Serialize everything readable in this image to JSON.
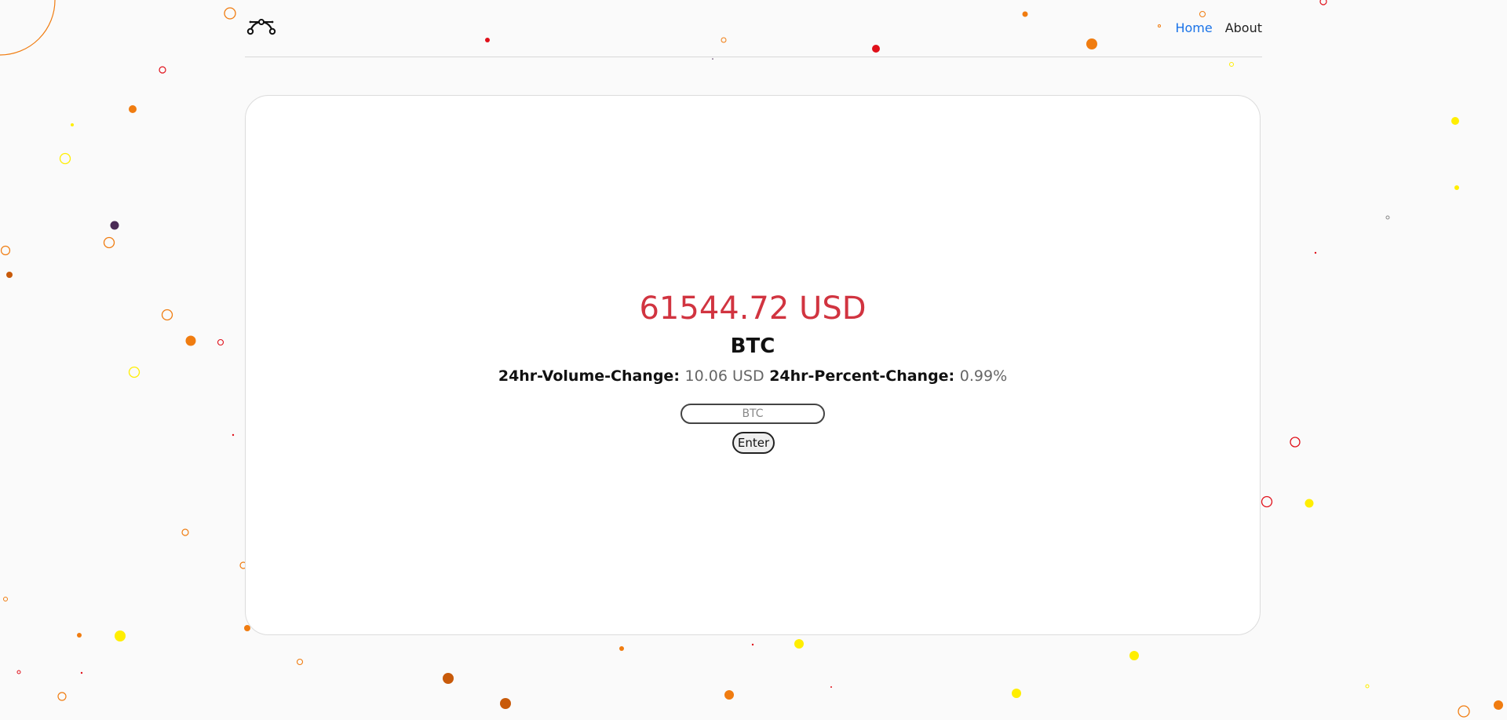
{
  "nav": {
    "logo_icon": "bezier-curve-icon",
    "links": [
      {
        "label": "Home",
        "active": true
      },
      {
        "label": "About",
        "active": false
      }
    ]
  },
  "ticker": {
    "price": "61544.72 USD",
    "symbol": "BTC",
    "volume_label": "24hr-Volume-Change:",
    "volume_value": "10.06 USD",
    "percent_label": "24hr-Percent-Change:",
    "percent_value": "0.99%"
  },
  "search": {
    "placeholder": "BTC",
    "button_label": "Enter"
  },
  "colors": {
    "price": "#d13440",
    "active_link": "#1a73e8",
    "particle_orange": "#f07c10",
    "particle_dark_orange": "#c85a0a",
    "particle_yellow": "#ffee00",
    "particle_red": "#e0101a",
    "particle_purple": "#4a2a55"
  }
}
